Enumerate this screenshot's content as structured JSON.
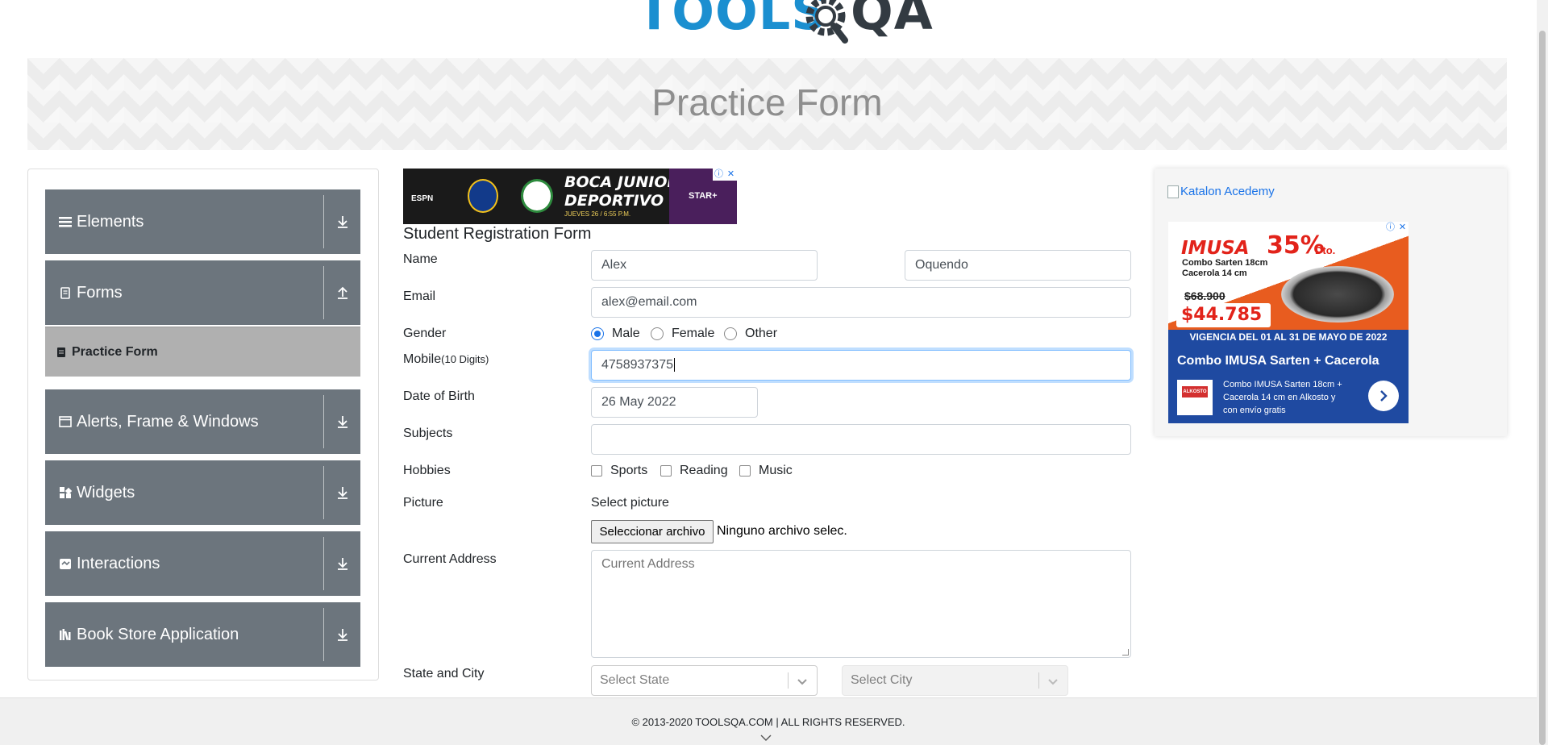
{
  "header": {
    "logo_text_1": "TOOLS",
    "logo_text_2": "QA",
    "page_title": "Practice Form"
  },
  "sidebar": {
    "groups": [
      {
        "label": "Elements",
        "icon": "hamburger-icon",
        "toggle": "download-arrow-icon"
      },
      {
        "label": "Forms",
        "icon": "document-icon",
        "toggle": "upload-arrow-icon"
      },
      {
        "label": "Alerts, Frame & Windows",
        "icon": "window-icon",
        "toggle": "download-arrow-icon"
      },
      {
        "label": "Widgets",
        "icon": "grid-icon",
        "toggle": "download-arrow-icon"
      },
      {
        "label": "Interactions",
        "icon": "interaction-icon",
        "toggle": "download-arrow-icon"
      },
      {
        "label": "Book Store Application",
        "icon": "books-icon",
        "toggle": "download-arrow-icon"
      }
    ],
    "active_item": {
      "label": "Practice Form",
      "icon": "form-doc-icon"
    }
  },
  "ad_top": {
    "line1": "BOCA JUNIORS",
    "line2": "DEPORTIVO CALI",
    "date": "JUEVES 26 / 6:55 P.M.",
    "network": "ESPN",
    "service": "STAR+"
  },
  "form": {
    "title": "Student Registration Form",
    "labels": {
      "name": "Name",
      "email": "Email",
      "gender": "Gender",
      "mobile": "Mobile",
      "mobile_hint": "(10 Digits)",
      "dob": "Date of Birth",
      "subjects": "Subjects",
      "hobbies": "Hobbies",
      "picture": "Picture",
      "address": "Current Address",
      "state_city": "State and City"
    },
    "first_name": "Alex",
    "last_name": "Oquendo",
    "email": "alex@email.com",
    "gender_options": [
      "Male",
      "Female",
      "Other"
    ],
    "gender_selected": "Male",
    "mobile": "4758937375",
    "dob": "26 May 2022",
    "subjects": "",
    "hobbies": [
      "Sports",
      "Reading",
      "Music"
    ],
    "picture_label": "Select picture",
    "file_button": "Seleccionar archivo",
    "file_status": "Ninguno archivo selec.",
    "address_placeholder": "Current Address",
    "state_placeholder": "Select State",
    "city_placeholder": "Select City"
  },
  "right_ad": {
    "alt_link": "Katalon Acedemy",
    "brand": "IMUSA",
    "discount": "35%",
    "discount_suffix": "Dto.",
    "product_desc": "Combo Sarten 18cm Cacerola 14 cm",
    "old_price": "$68.900",
    "price": "$44.785",
    "validity": "VIGENCIA DEL 01 AL 31 DE MAYO DE 2022",
    "headline": "Combo IMUSA Sarten + Cacerola",
    "body": "Combo IMUSA Sarten 18cm + Cacerola 14 cm en Alkosto y con envío gratis",
    "store": "ALKOSTO"
  },
  "footer": {
    "text": "© 2013-2020 TOOLSQA.COM | ALL RIGHTS RESERVED."
  }
}
